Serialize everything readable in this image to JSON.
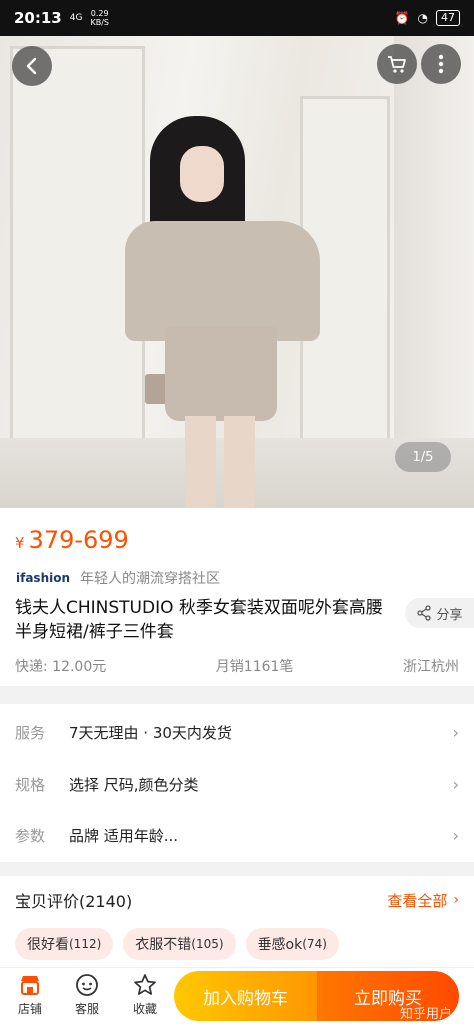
{
  "status_bar": {
    "time": "20:13",
    "signal": "4G",
    "speed_value": "0.29",
    "speed_unit": "KB/S",
    "battery": "47"
  },
  "gallery": {
    "counter": "1/5"
  },
  "product": {
    "currency": "¥",
    "price_range": "379-699",
    "brand_logo_text": "ifashion",
    "brand_slogan": "年轻人的潮流穿搭社区",
    "title": "钱夫人CHINSTUDIO 秋季女套装双面呢外套高腰半身短裙/裤子三件套",
    "share_label": "分享",
    "shipping": "快递: 12.00元",
    "monthly_sales": "月销1161笔",
    "location": "浙江杭州"
  },
  "services": [
    {
      "label": "服务",
      "value": "7天无理由 · 30天内发货"
    },
    {
      "label": "规格",
      "value": "选择 尺码,颜色分类"
    },
    {
      "label": "参数",
      "value": "品牌 适用年龄..."
    }
  ],
  "reviews": {
    "title": "宝贝评价(2140)",
    "view_all": "查看全部",
    "tags": [
      {
        "text": "很好看",
        "count": "(112)"
      },
      {
        "text": "衣服不错",
        "count": "(105)"
      },
      {
        "text": "垂感ok",
        "count": "(74)"
      }
    ]
  },
  "bottom_bar": {
    "shop": "店铺",
    "service": "客服",
    "favorite": "收藏",
    "add_to_cart": "加入购物车",
    "buy_now": "立即购买"
  },
  "watermark": "知乎用户",
  "colors": {
    "accent": "#ff5000",
    "cart_button": "#ffa800",
    "buy_button": "#ff5a00"
  }
}
